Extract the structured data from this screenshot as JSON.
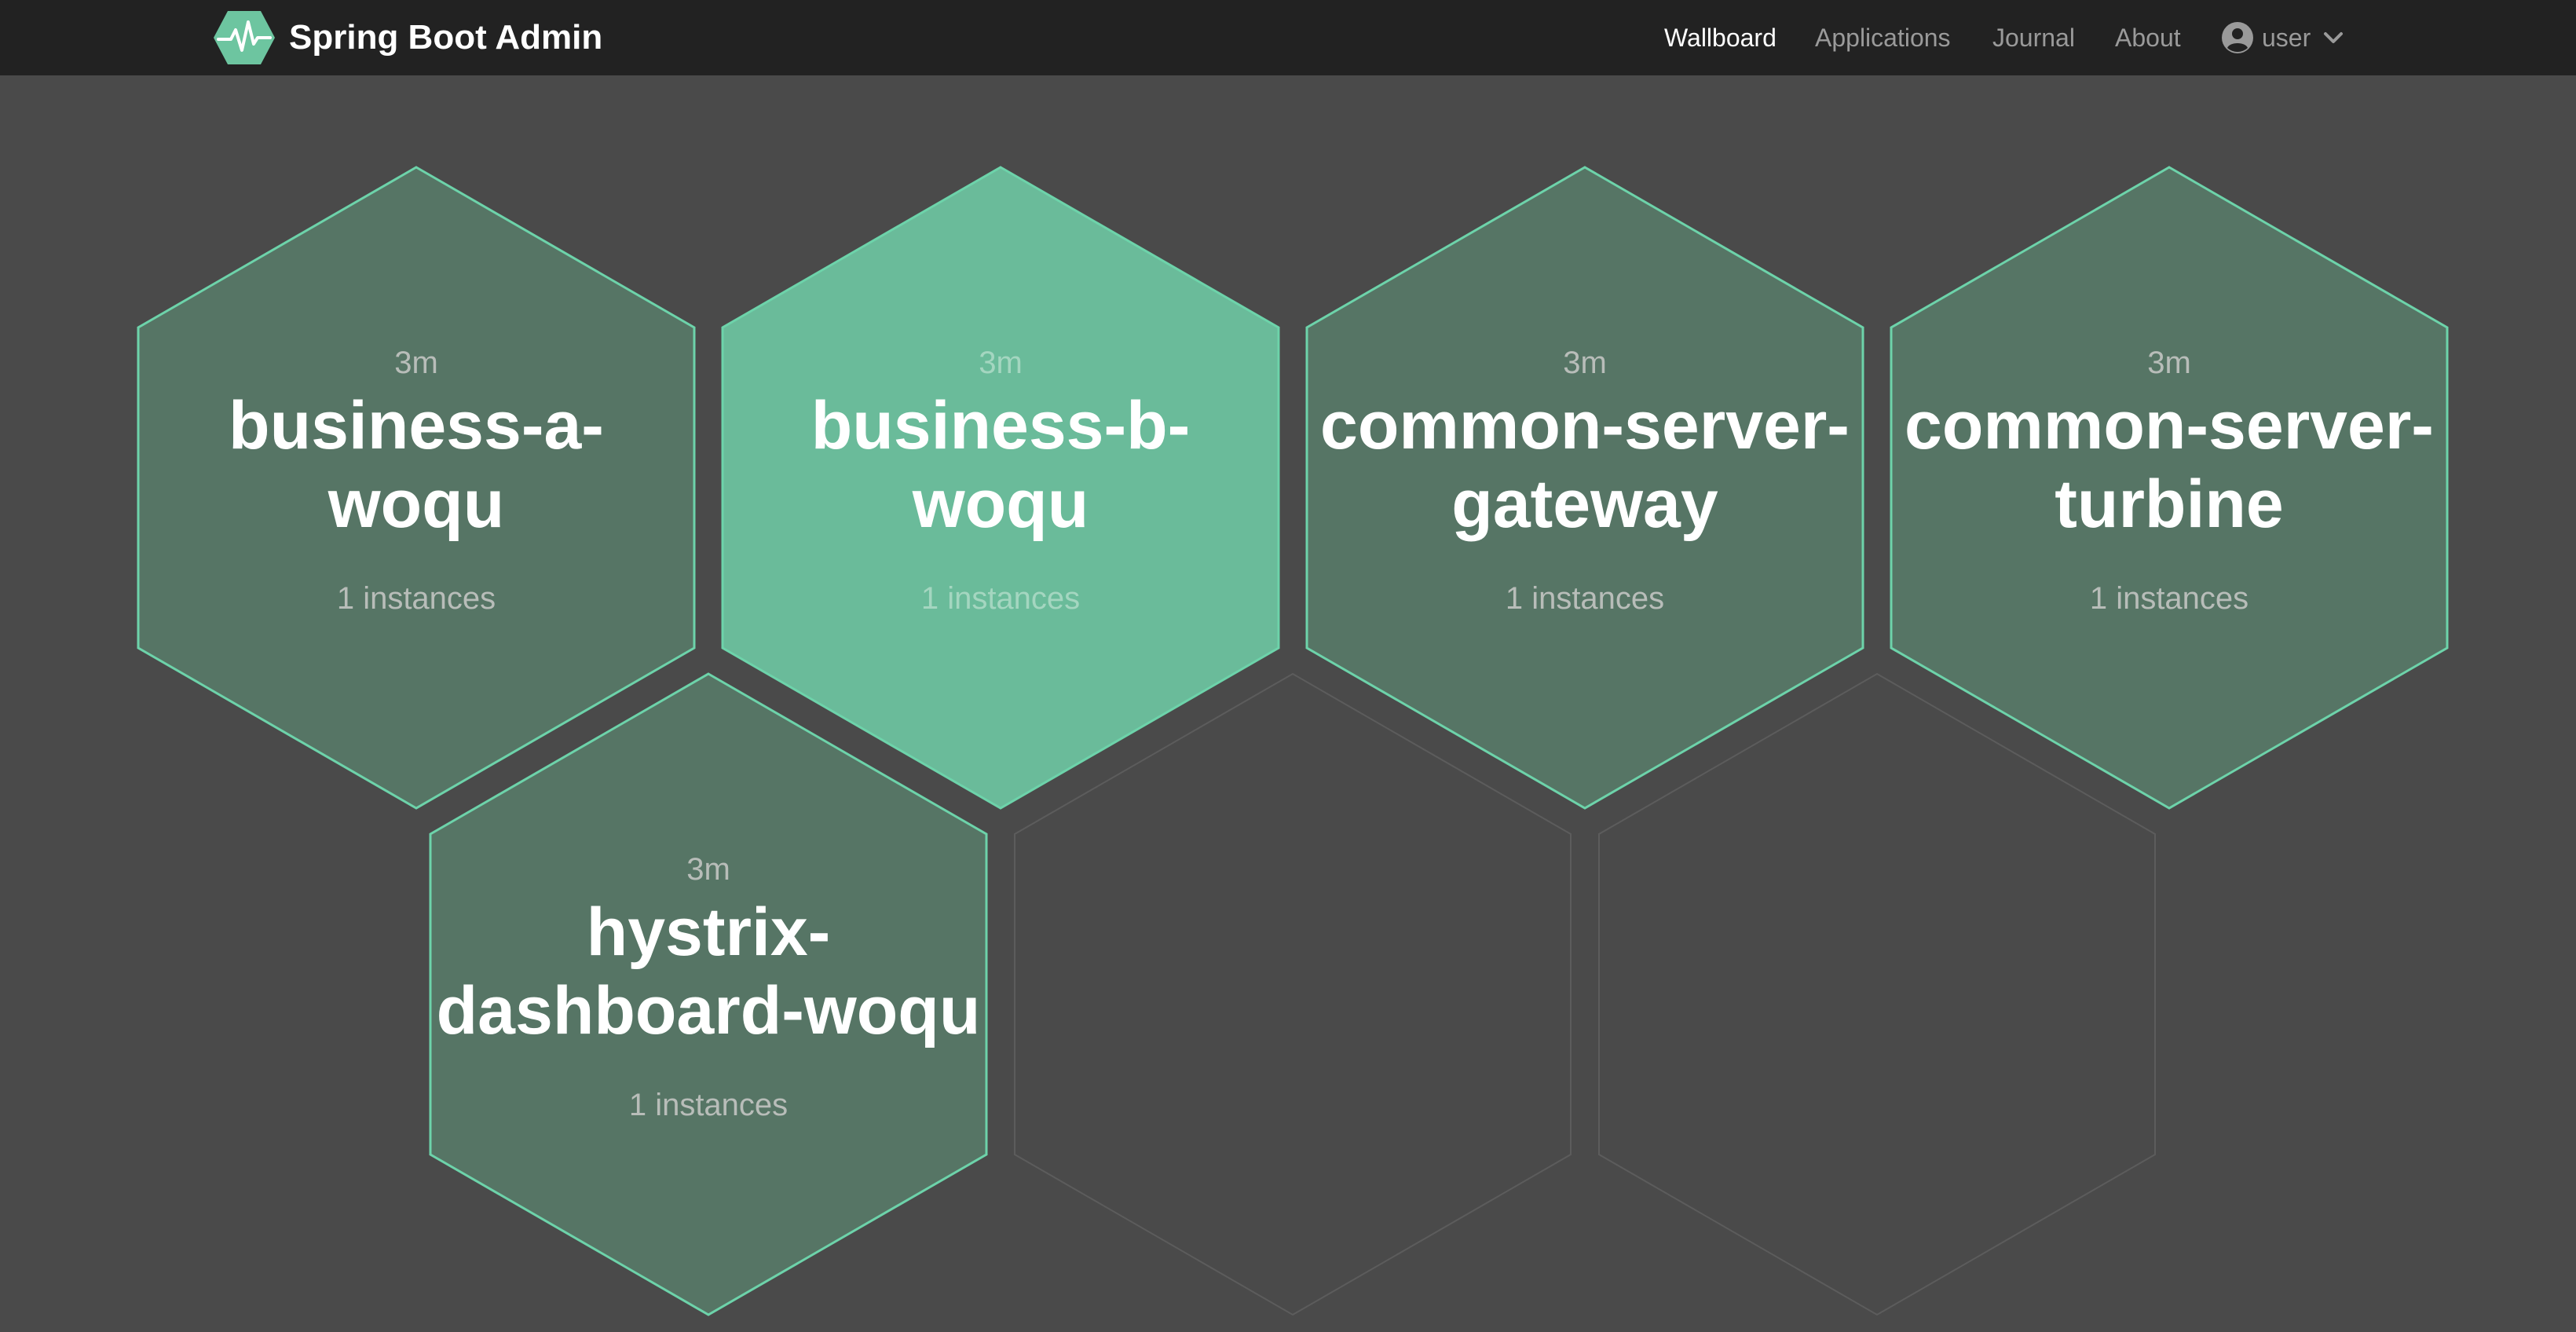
{
  "navbar": {
    "brand": {
      "name": "Spring Boot Admin",
      "logo_icon": "heartbeat-hexagon-icon",
      "logo_color": "#6dc5a0"
    },
    "items": [
      {
        "label": "Wallboard",
        "active": true
      },
      {
        "label": "Applications",
        "active": false
      },
      {
        "label": "Journal",
        "active": false
      },
      {
        "label": "About",
        "active": false
      }
    ],
    "user": {
      "label": "user",
      "icon": "user-circle-icon",
      "dropdown_icon": "chevron-down-icon"
    }
  },
  "wallboard": {
    "applications": [
      {
        "name": "business-a-woqu",
        "name_lines": [
          "business-a-",
          "woqu"
        ],
        "time": "3m",
        "instances": "1 instances",
        "highlighted": false
      },
      {
        "name": "business-b-woqu",
        "name_lines": [
          "business-b-",
          "woqu"
        ],
        "time": "3m",
        "instances": "1 instances",
        "highlighted": true
      },
      {
        "name": "common-server-gateway",
        "name_lines": [
          "common-server-",
          "gateway"
        ],
        "time": "3m",
        "instances": "1 instances",
        "highlighted": false
      },
      {
        "name": "common-server-turbine",
        "name_lines": [
          "common-server-",
          "turbine"
        ],
        "time": "3m",
        "instances": "1 instances",
        "highlighted": false
      },
      {
        "name": "hystrix-dashboard-woqu",
        "name_lines": [
          "hystrix-",
          "dashboard-woqu"
        ],
        "time": "3m",
        "instances": "1 instances",
        "highlighted": false
      }
    ],
    "empty_cells": 2,
    "colors": {
      "up_fill": "#567565",
      "highlight_fill": "#6abb9a",
      "up_stroke": "#6dd3aa",
      "empty_stroke": "#5c5c5c",
      "meta_text": "#b8bdb9",
      "meta_text_highlight": "#a4d6c0",
      "name_text": "#ffffff"
    }
  }
}
